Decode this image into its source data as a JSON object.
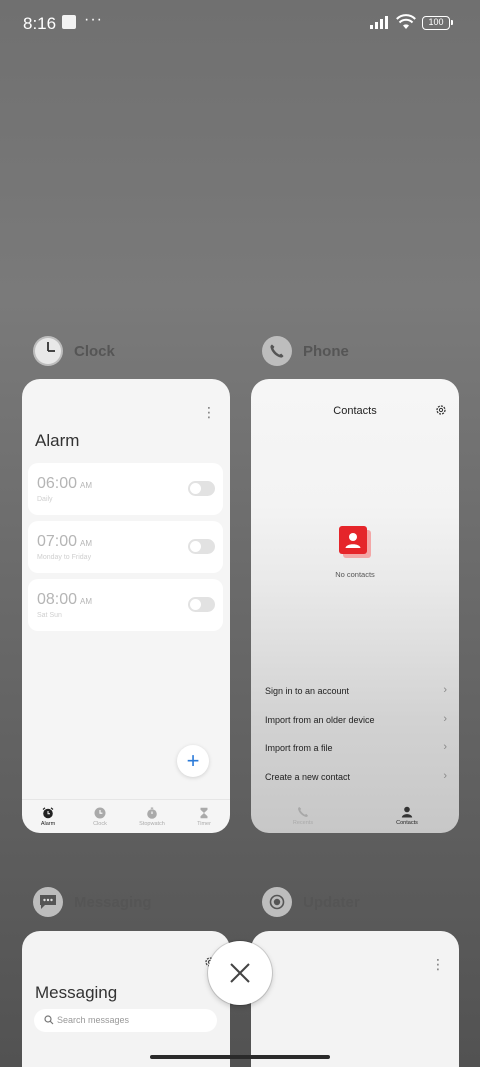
{
  "status_bar": {
    "time": "8:16",
    "dots": "···",
    "battery": "100"
  },
  "apps": [
    {
      "name": "Clock",
      "screen": {
        "title": "Alarm",
        "alarms": [
          {
            "time": "06:00",
            "ampm": "AM",
            "label": "Daily"
          },
          {
            "time": "07:00",
            "ampm": "AM",
            "label": "Monday to Friday"
          },
          {
            "time": "08:00",
            "ampm": "AM",
            "label": "Sat Sun"
          }
        ],
        "add_label": "+",
        "nav": [
          "Alarm",
          "Clock",
          "Stopwatch",
          "Timer"
        ]
      }
    },
    {
      "name": "Phone",
      "screen": {
        "title": "Contacts",
        "empty_text": "No contacts",
        "options": [
          "Sign in to an account",
          "Import from an older device",
          "Import from a file",
          "Create a new contact"
        ],
        "nav": [
          "Recents",
          "Contacts"
        ]
      }
    },
    {
      "name": "Messaging",
      "screen": {
        "title": "Messaging",
        "search_placeholder": "Search messages"
      }
    },
    {
      "name": "Updater"
    }
  ],
  "colors": {
    "accent_blue": "#2a7ad8",
    "contacts_red": "#e5252a"
  }
}
